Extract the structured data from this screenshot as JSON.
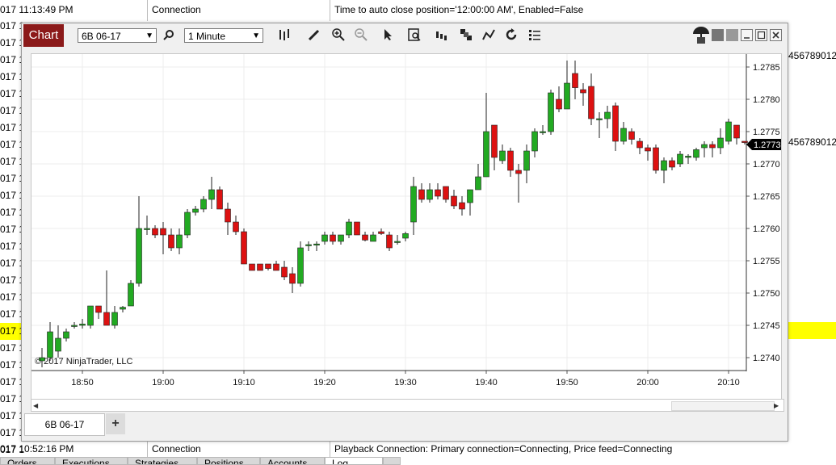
{
  "log_header": {
    "time": "017 11:13:49 PM",
    "category": "Connection",
    "message": "Time to auto close position='12:00:00 AM', Enabled=False"
  },
  "log_footer": {
    "time": "017 10:52:16 PM",
    "category": "Connection",
    "message": "Playback Connection: Primary connection=Connecting, Price feed=Connecting"
  },
  "log_rows": [
    "017 1",
    "017 1",
    "017 1",
    "017 1",
    "017 1",
    "017 1",
    "017 1",
    "017 1",
    "017 1",
    "017 1",
    "017 1",
    "017 1",
    "017 1",
    "017 1",
    "017 1",
    "017 1",
    "017 1",
    "017 1",
    "017 1",
    "017 1",
    "017 1",
    "017 1",
    "017 1",
    "017 1",
    "017 1",
    "017 1"
  ],
  "right_values": [
    "456789012",
    "456789012"
  ],
  "bottom_tabs": [
    "Orders",
    "Executions",
    "Strategies",
    "Positions",
    "Accounts",
    "Log"
  ],
  "toolbar": {
    "chart_label": "Chart",
    "instrument": "6B 06-17",
    "interval": "1 Minute"
  },
  "instrument_tab": "6B 06-17",
  "add_tab": "+",
  "copyright": "© 2017 NinjaTrader, LLC",
  "current_price_label": "1.2773",
  "colors": {
    "up": "#22aa22",
    "down": "#dd1111",
    "accent": "#8b1a1a",
    "highlight": "#ffff00"
  },
  "chart_data": {
    "type": "candlestick",
    "instrument": "6B 06-17",
    "interval": "1 Minute",
    "x_tick_labels": [
      "18:50",
      "19:00",
      "19:10",
      "19:20",
      "19:30",
      "19:40",
      "19:50",
      "20:00",
      "20:10"
    ],
    "y_tick_labels": [
      "1.2785",
      "1.2780",
      "1.2775",
      "1.2770",
      "1.2765",
      "1.2760",
      "1.2755",
      "1.2750",
      "1.2745",
      "1.2740"
    ],
    "ylim": [
      1.2738,
      1.2787
    ],
    "current_price": 1.2773,
    "grid": true,
    "candles": [
      {
        "t": "18:45",
        "o": 1.27395,
        "h": 1.27415,
        "l": 1.27385,
        "c": 1.274
      },
      {
        "t": "18:46",
        "o": 1.274,
        "h": 1.27455,
        "l": 1.27395,
        "c": 1.2744
      },
      {
        "t": "18:47",
        "o": 1.2741,
        "h": 1.2745,
        "l": 1.274,
        "c": 1.2743
      },
      {
        "t": "18:48",
        "o": 1.2743,
        "h": 1.27445,
        "l": 1.27425,
        "c": 1.2744
      },
      {
        "t": "18:49",
        "o": 1.2745,
        "h": 1.27455,
        "l": 1.27445,
        "c": 1.2745
      },
      {
        "t": "18:50",
        "o": 1.2745,
        "h": 1.2746,
        "l": 1.27445,
        "c": 1.27452
      },
      {
        "t": "18:51",
        "o": 1.2745,
        "h": 1.2748,
        "l": 1.27445,
        "c": 1.2748
      },
      {
        "t": "18:52",
        "o": 1.2748,
        "h": 1.2748,
        "l": 1.2746,
        "c": 1.2747
      },
      {
        "t": "18:53",
        "o": 1.2747,
        "h": 1.27535,
        "l": 1.2745,
        "c": 1.2745
      },
      {
        "t": "18:54",
        "o": 1.2745,
        "h": 1.2748,
        "l": 1.27445,
        "c": 1.2747
      },
      {
        "t": "18:55",
        "o": 1.27475,
        "h": 1.2748,
        "l": 1.2747,
        "c": 1.27478
      },
      {
        "t": "18:56",
        "o": 1.2748,
        "h": 1.2752,
        "l": 1.2748,
        "c": 1.27515
      },
      {
        "t": "18:57",
        "o": 1.27515,
        "h": 1.2765,
        "l": 1.2751,
        "c": 1.276
      },
      {
        "t": "18:58",
        "o": 1.276,
        "h": 1.2762,
        "l": 1.2759,
        "c": 1.276
      },
      {
        "t": "18:59",
        "o": 1.276,
        "h": 1.27605,
        "l": 1.27585,
        "c": 1.2759
      },
      {
        "t": "19:00",
        "o": 1.276,
        "h": 1.2761,
        "l": 1.2756,
        "c": 1.2759
      },
      {
        "t": "19:01",
        "o": 1.2759,
        "h": 1.276,
        "l": 1.27565,
        "c": 1.2757
      },
      {
        "t": "19:02",
        "o": 1.2757,
        "h": 1.276,
        "l": 1.2756,
        "c": 1.2759
      },
      {
        "t": "19:03",
        "o": 1.2759,
        "h": 1.2763,
        "l": 1.27585,
        "c": 1.27625
      },
      {
        "t": "19:04",
        "o": 1.27625,
        "h": 1.27635,
        "l": 1.2762,
        "c": 1.2763
      },
      {
        "t": "19:05",
        "o": 1.2763,
        "h": 1.2765,
        "l": 1.27625,
        "c": 1.27645
      },
      {
        "t": "19:06",
        "o": 1.27645,
        "h": 1.2768,
        "l": 1.2763,
        "c": 1.2766
      },
      {
        "t": "19:07",
        "o": 1.2766,
        "h": 1.27665,
        "l": 1.2763,
        "c": 1.2763
      },
      {
        "t": "19:08",
        "o": 1.2763,
        "h": 1.2764,
        "l": 1.2759,
        "c": 1.2761
      },
      {
        "t": "19:09",
        "o": 1.2761,
        "h": 1.2762,
        "l": 1.2759,
        "c": 1.27595
      },
      {
        "t": "19:10",
        "o": 1.27595,
        "h": 1.276,
        "l": 1.27545,
        "c": 1.27545
      },
      {
        "t": "19:11",
        "o": 1.27545,
        "h": 1.27545,
        "l": 1.27535,
        "c": 1.27535
      },
      {
        "t": "19:12",
        "o": 1.27545,
        "h": 1.27545,
        "l": 1.27535,
        "c": 1.27535
      },
      {
        "t": "19:13",
        "o": 1.27545,
        "h": 1.27545,
        "l": 1.27535,
        "c": 1.27538
      },
      {
        "t": "19:14",
        "o": 1.27545,
        "h": 1.2755,
        "l": 1.27535,
        "c": 1.27535
      },
      {
        "t": "19:15",
        "o": 1.2754,
        "h": 1.2755,
        "l": 1.2752,
        "c": 1.27525
      },
      {
        "t": "19:16",
        "o": 1.2753,
        "h": 1.2754,
        "l": 1.275,
        "c": 1.27515
      },
      {
        "t": "19:17",
        "o": 1.27515,
        "h": 1.2758,
        "l": 1.2751,
        "c": 1.2757
      },
      {
        "t": "19:18",
        "o": 1.27575,
        "h": 1.2758,
        "l": 1.27565,
        "c": 1.27575
      },
      {
        "t": "19:19",
        "o": 1.27575,
        "h": 1.2758,
        "l": 1.27565,
        "c": 1.27576
      },
      {
        "t": "19:20",
        "o": 1.2758,
        "h": 1.27595,
        "l": 1.27575,
        "c": 1.2759
      },
      {
        "t": "19:21",
        "o": 1.2759,
        "h": 1.27595,
        "l": 1.27575,
        "c": 1.2758
      },
      {
        "t": "19:22",
        "o": 1.2758,
        "h": 1.2759,
        "l": 1.27575,
        "c": 1.2759
      },
      {
        "t": "19:23",
        "o": 1.2759,
        "h": 1.27615,
        "l": 1.27585,
        "c": 1.2761
      },
      {
        "t": "19:24",
        "o": 1.2761,
        "h": 1.2761,
        "l": 1.2759,
        "c": 1.2759
      },
      {
        "t": "19:25",
        "o": 1.2759,
        "h": 1.27595,
        "l": 1.2758,
        "c": 1.27582
      },
      {
        "t": "19:26",
        "o": 1.2758,
        "h": 1.27595,
        "l": 1.2758,
        "c": 1.2759
      },
      {
        "t": "19:27",
        "o": 1.27595,
        "h": 1.276,
        "l": 1.2759,
        "c": 1.27592
      },
      {
        "t": "19:28",
        "o": 1.2759,
        "h": 1.27595,
        "l": 1.27565,
        "c": 1.2757
      },
      {
        "t": "19:29",
        "o": 1.2758,
        "h": 1.2759,
        "l": 1.27575,
        "c": 1.2758
      },
      {
        "t": "19:30",
        "o": 1.27585,
        "h": 1.27595,
        "l": 1.2758,
        "c": 1.27592
      },
      {
        "t": "19:31",
        "o": 1.2761,
        "h": 1.2768,
        "l": 1.2759,
        "c": 1.27665
      },
      {
        "t": "19:32",
        "o": 1.2766,
        "h": 1.2767,
        "l": 1.2764,
        "c": 1.27645
      },
      {
        "t": "19:33",
        "o": 1.27645,
        "h": 1.2767,
        "l": 1.2764,
        "c": 1.2766
      },
      {
        "t": "19:34",
        "o": 1.2766,
        "h": 1.2767,
        "l": 1.27645,
        "c": 1.2765
      },
      {
        "t": "19:35",
        "o": 1.27665,
        "h": 1.27665,
        "l": 1.2764,
        "c": 1.27645
      },
      {
        "t": "19:36",
        "o": 1.2765,
        "h": 1.2766,
        "l": 1.2763,
        "c": 1.27635
      },
      {
        "t": "19:37",
        "o": 1.2764,
        "h": 1.2765,
        "l": 1.2762,
        "c": 1.2763
      },
      {
        "t": "19:38",
        "o": 1.2764,
        "h": 1.2766,
        "l": 1.2762,
        "c": 1.2766
      },
      {
        "t": "19:39",
        "o": 1.2766,
        "h": 1.277,
        "l": 1.2766,
        "c": 1.2768
      },
      {
        "t": "19:40",
        "o": 1.2768,
        "h": 1.2781,
        "l": 1.2768,
        "c": 1.2775
      },
      {
        "t": "19:41",
        "o": 1.2776,
        "h": 1.2776,
        "l": 1.2769,
        "c": 1.2771
      },
      {
        "t": "19:42",
        "o": 1.27705,
        "h": 1.2773,
        "l": 1.277,
        "c": 1.2772
      },
      {
        "t": "19:43",
        "o": 1.2772,
        "h": 1.27725,
        "l": 1.2768,
        "c": 1.2769
      },
      {
        "t": "19:44",
        "o": 1.2769,
        "h": 1.277,
        "l": 1.2764,
        "c": 1.27685
      },
      {
        "t": "19:45",
        "o": 1.2769,
        "h": 1.2773,
        "l": 1.2767,
        "c": 1.2772
      },
      {
        "t": "19:46",
        "o": 1.2772,
        "h": 1.27755,
        "l": 1.2771,
        "c": 1.2775
      },
      {
        "t": "19:47",
        "o": 1.2775,
        "h": 1.2776,
        "l": 1.27745,
        "c": 1.2775
      },
      {
        "t": "19:48",
        "o": 1.2775,
        "h": 1.27815,
        "l": 1.27745,
        "c": 1.2781
      },
      {
        "t": "19:49",
        "o": 1.278,
        "h": 1.2782,
        "l": 1.2778,
        "c": 1.27785
      },
      {
        "t": "19:50",
        "o": 1.27785,
        "h": 1.2786,
        "l": 1.27785,
        "c": 1.27825
      },
      {
        "t": "19:51",
        "o": 1.2784,
        "h": 1.2786,
        "l": 1.278,
        "c": 1.27818
      },
      {
        "t": "19:52",
        "o": 1.27815,
        "h": 1.27825,
        "l": 1.2779,
        "c": 1.2781
      },
      {
        "t": "19:53",
        "o": 1.2782,
        "h": 1.2784,
        "l": 1.2776,
        "c": 1.2777
      },
      {
        "t": "19:54",
        "o": 1.2777,
        "h": 1.2778,
        "l": 1.2774,
        "c": 1.2777
      },
      {
        "t": "19:55",
        "o": 1.2777,
        "h": 1.2779,
        "l": 1.27755,
        "c": 1.2778
      },
      {
        "t": "19:56",
        "o": 1.2779,
        "h": 1.27795,
        "l": 1.2772,
        "c": 1.27735
      },
      {
        "t": "19:57",
        "o": 1.27735,
        "h": 1.27765,
        "l": 1.2773,
        "c": 1.27755
      },
      {
        "t": "19:58",
        "o": 1.2775,
        "h": 1.27755,
        "l": 1.2773,
        "c": 1.27738
      },
      {
        "t": "19:59",
        "o": 1.27735,
        "h": 1.2774,
        "l": 1.27715,
        "c": 1.27725
      },
      {
        "t": "20:00",
        "o": 1.27725,
        "h": 1.2773,
        "l": 1.27705,
        "c": 1.2772
      },
      {
        "t": "20:01",
        "o": 1.27725,
        "h": 1.2773,
        "l": 1.27685,
        "c": 1.2769
      },
      {
        "t": "20:02",
        "o": 1.2769,
        "h": 1.2771,
        "l": 1.2767,
        "c": 1.27705
      },
      {
        "t": "20:03",
        "o": 1.27705,
        "h": 1.2771,
        "l": 1.2769,
        "c": 1.27695
      },
      {
        "t": "20:04",
        "o": 1.277,
        "h": 1.2772,
        "l": 1.27695,
        "c": 1.27715
      },
      {
        "t": "20:05",
        "o": 1.2771,
        "h": 1.27715,
        "l": 1.277,
        "c": 1.27712
      },
      {
        "t": "20:06",
        "o": 1.2771,
        "h": 1.27725,
        "l": 1.27705,
        "c": 1.27722
      },
      {
        "t": "20:07",
        "o": 1.27725,
        "h": 1.27735,
        "l": 1.2771,
        "c": 1.2773
      },
      {
        "t": "20:08",
        "o": 1.2773,
        "h": 1.27735,
        "l": 1.2771,
        "c": 1.27725
      },
      {
        "t": "20:09",
        "o": 1.27725,
        "h": 1.27755,
        "l": 1.27715,
        "c": 1.2774
      },
      {
        "t": "20:10",
        "o": 1.27735,
        "h": 1.2777,
        "l": 1.2773,
        "c": 1.27765
      },
      {
        "t": "20:11",
        "o": 1.2776,
        "h": 1.2776,
        "l": 1.2773,
        "c": 1.2774
      },
      {
        "t": "20:12",
        "o": 1.27735,
        "h": 1.27735,
        "l": 1.2773,
        "c": 1.27733
      }
    ]
  }
}
